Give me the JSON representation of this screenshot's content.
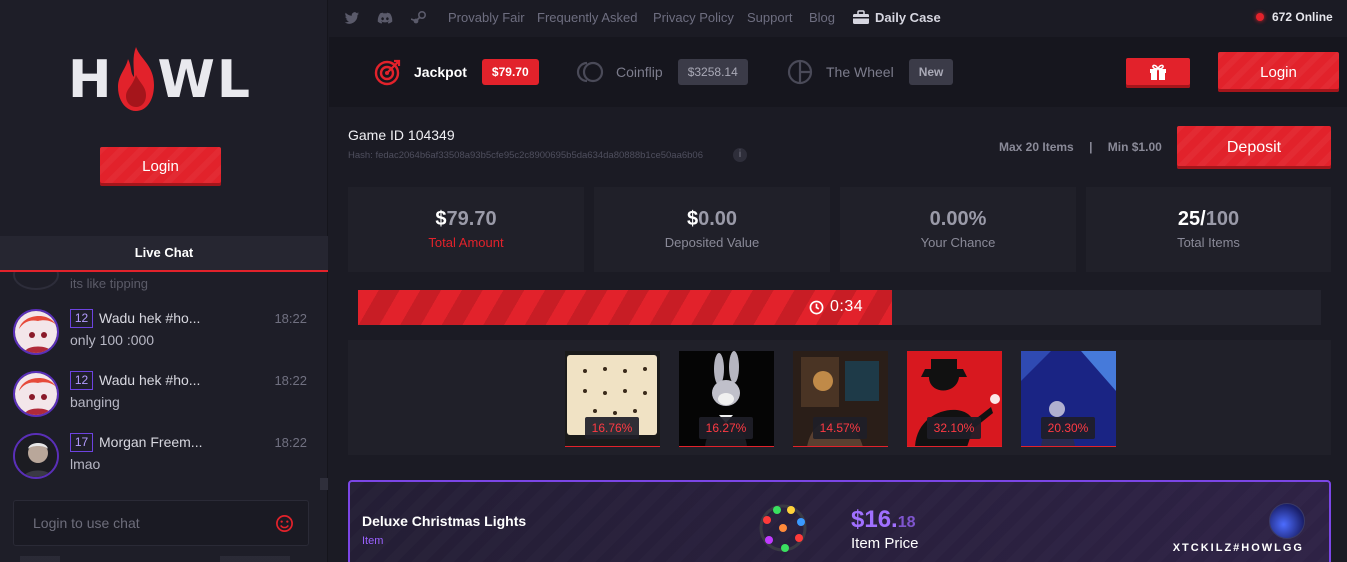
{
  "brand": {
    "logo_left": "H",
    "logo_right": "WL"
  },
  "sidebar": {
    "login_label": "Login",
    "chat_title": "Live Chat",
    "ghost_message": "its like tipping",
    "messages": [
      {
        "level": "12",
        "name": "Wadu hek #ho...",
        "time": "18:22",
        "text": "only 100 :000"
      },
      {
        "level": "12",
        "name": "Wadu hek #ho...",
        "time": "18:22",
        "text": "banging"
      },
      {
        "level": "17",
        "name": "Morgan Freem...",
        "time": "18:22",
        "text": "lmao"
      }
    ],
    "chat_placeholder": "Login to use chat"
  },
  "topnav": {
    "links": [
      "Provably Fair",
      "Frequently Asked",
      "Privacy Policy",
      "Support",
      "Blog"
    ],
    "daily_case": "Daily Case",
    "online": "672 Online"
  },
  "tabs": [
    {
      "label": "Jackpot",
      "badge": "$79.70",
      "active": true
    },
    {
      "label": "Coinflip",
      "badge": "$3258.14",
      "active": false
    },
    {
      "label": "The Wheel",
      "badge": "New",
      "active": false
    }
  ],
  "header_login_label": "Login",
  "game": {
    "id_label": "Game ID 104349",
    "hash": "Hash: fedac2064b6af33508a93b5cfe95c2c8900695b5da634da80888b1ce50aa6b06",
    "info_icon": "i",
    "max_items": "Max 20 Items",
    "separator": "|",
    "min_amount": "Min $1.00",
    "deposit_label": "Deposit"
  },
  "stats": [
    {
      "prefix": "$",
      "value": "79.70",
      "label": "Total Amount"
    },
    {
      "prefix": "$",
      "value": "0.00",
      "label": "Deposited Value"
    },
    {
      "prefix": "",
      "value": "0.00%",
      "label": "Your Chance"
    },
    {
      "prefix": "25/",
      "value": "100",
      "label": "Total Items"
    }
  ],
  "timer": {
    "text": "0:34",
    "progress": 0.555
  },
  "pot_items": [
    {
      "percent": "16.76%"
    },
    {
      "percent": "16.27%"
    },
    {
      "percent": "14.57%"
    },
    {
      "percent": "32.10%"
    },
    {
      "percent": "20.30%"
    }
  ],
  "deposited_item": {
    "name": "Deluxe Christmas Lights",
    "type": "Item",
    "price_main": "$16.",
    "price_cents": "18",
    "price_label": "Item Price",
    "user": "XTCKILZ#HOWLGG"
  },
  "colors": {
    "accent": "#e2222b",
    "purple": "#7b46e6",
    "bg": "#1b1b24"
  }
}
